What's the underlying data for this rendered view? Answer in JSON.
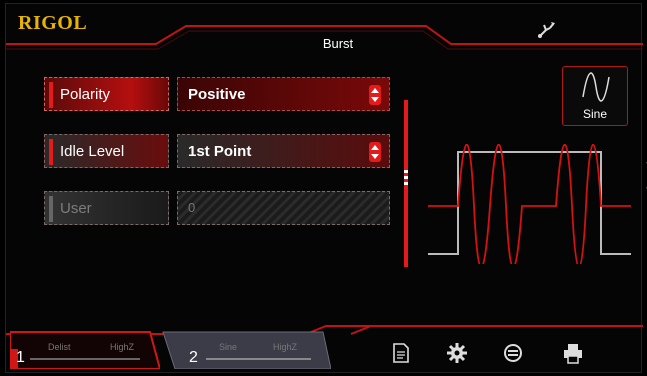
{
  "header": {
    "brand": "RIGOL",
    "title": "Burst",
    "usb_icon": "usb-icon"
  },
  "params": [
    {
      "label": "Polarity",
      "value": "Positive",
      "state": "active"
    },
    {
      "label": "Idle Level",
      "value": "1st Point",
      "state": "normal"
    },
    {
      "label": "User",
      "value": "0",
      "state": "disabled"
    }
  ],
  "waveform": {
    "type_label": "Sine"
  },
  "channels": [
    {
      "num": "1",
      "mode": "Delist",
      "load": "HighZ"
    },
    {
      "num": "2",
      "mode": "Sine",
      "load": "HighZ"
    }
  ],
  "toolbar": [
    "document-icon",
    "gear-icon",
    "sync-icon",
    "printer-icon"
  ],
  "colors": {
    "accent": "#e41b1b",
    "brand": "#e8b400",
    "channel2": "#4a4a5a"
  }
}
